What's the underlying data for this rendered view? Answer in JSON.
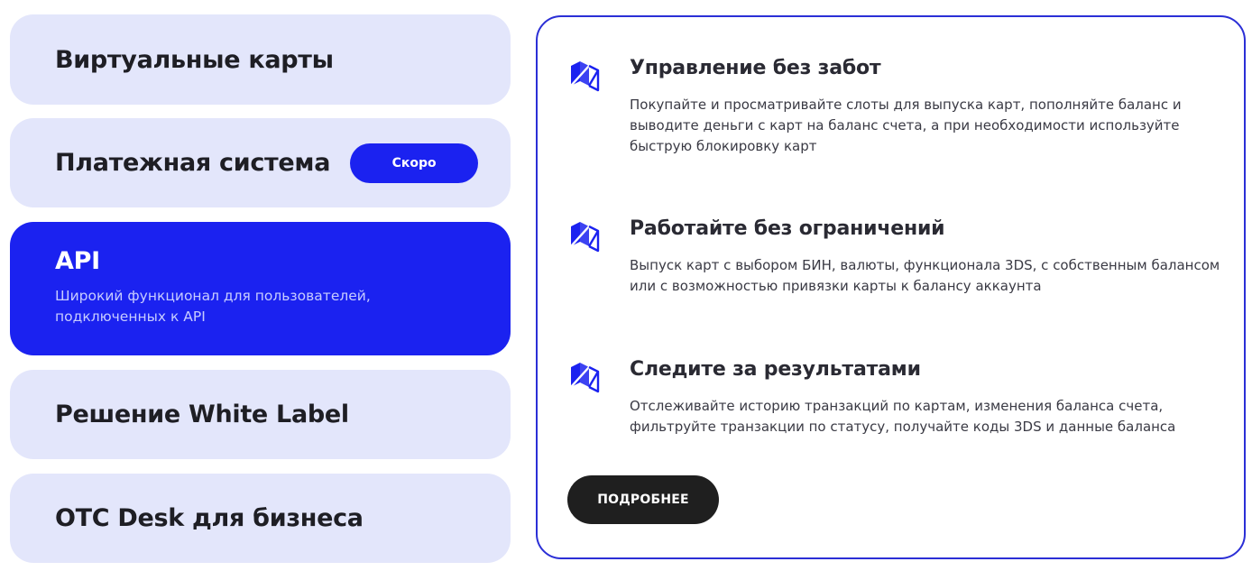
{
  "colors": {
    "accent": "#1b22f0",
    "menu_bg": "#e3e6fb",
    "panel_border": "#2b2fd6",
    "button_dark": "#1f1f1f"
  },
  "menu": {
    "items": [
      {
        "title": "Виртуальные карты"
      },
      {
        "title": "Платежная система",
        "badge": "Скоро"
      },
      {
        "title": "API",
        "description": "Широкий функционал для пользователей, подключенных к API",
        "active": true
      },
      {
        "title": "Решение White Label"
      },
      {
        "title": "OTC Desk для бизнеса"
      }
    ]
  },
  "panel": {
    "features": [
      {
        "icon": "folded-square-icon",
        "title": "Управление без забот",
        "text": "Покупайте и просматривайте слоты для выпуска карт, пополняйте баланс и выводите деньги с карт на баланс счета, а при необходимости используйте быструю блокировку карт"
      },
      {
        "icon": "folded-square-icon",
        "title": "Работайте без ограничений",
        "text": "Выпуск карт с выбором БИН, валюты, функционала 3DS, с собственным балансом или с возможностью привязки карты к балансу аккаунта"
      },
      {
        "icon": "folded-square-icon",
        "title": "Следите за результатами",
        "text": "Отслеживайте историю транзакций по картам, изменения баланса счета, фильтруйте транзакции по статусу, получайте коды 3DS и данные баланса"
      }
    ],
    "more_label": "ПОДРОБНЕЕ"
  }
}
